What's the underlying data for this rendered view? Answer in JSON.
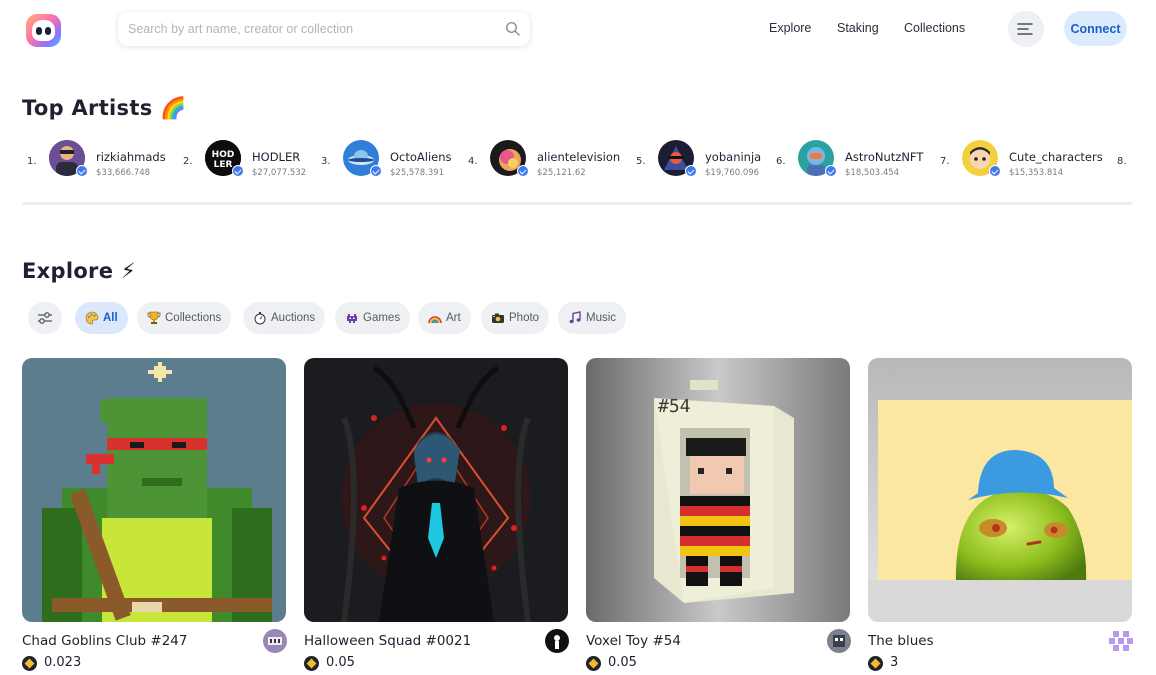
{
  "header": {
    "search_placeholder": "Search by art name, creator or collection",
    "nav": [
      "Explore",
      "Staking",
      "Collections"
    ],
    "connect_label": "Connect"
  },
  "top_artists": {
    "title": "Top Artists 🌈",
    "items": [
      {
        "rank": "1.",
        "name": "rizkiahmads",
        "value": "$33,666.748"
      },
      {
        "rank": "2.",
        "name": "HODLER",
        "value": "$27,077.532"
      },
      {
        "rank": "3.",
        "name": "OctoAliens",
        "value": "$25,578.391"
      },
      {
        "rank": "4.",
        "name": "alientelevision",
        "value": "$25,121.62"
      },
      {
        "rank": "5.",
        "name": "yobaninja",
        "value": "$19,760.096"
      },
      {
        "rank": "6.",
        "name": "AstroNutzNFT",
        "value": "$18,503.454"
      },
      {
        "rank": "7.",
        "name": "Cute_characters",
        "value": "$15,353.814"
      },
      {
        "rank": "8.",
        "name": "",
        "value": ""
      }
    ]
  },
  "explore": {
    "title": "Explore ⚡",
    "filters": [
      {
        "label": "All",
        "icon": "palette-icon",
        "active": true
      },
      {
        "label": "Collections",
        "icon": "trophy-icon",
        "active": false
      },
      {
        "label": "Auctions",
        "icon": "stopwatch-icon",
        "active": false
      },
      {
        "label": "Games",
        "icon": "space-invader-icon",
        "active": false
      },
      {
        "label": "Art",
        "icon": "rainbow-icon",
        "active": false
      },
      {
        "label": "Photo",
        "icon": "camera-icon",
        "active": false
      },
      {
        "label": "Music",
        "icon": "music-note-icon",
        "active": false
      }
    ],
    "cards": [
      {
        "title": "Chad Goblins Club #247",
        "price": "0.023"
      },
      {
        "title": "Halloween Squad #0021",
        "price": "0.05"
      },
      {
        "title": "Voxel Toy #54",
        "price": "0.05"
      },
      {
        "title": "The blues",
        "price": "3"
      }
    ]
  },
  "artwork_text": {
    "voxel_label": "#54",
    "hodler_logo": "HOD LER"
  },
  "colors": {
    "accent": "#1b5fc4",
    "accent_bg": "#dbeafd",
    "verified_badge": "#3f7bea"
  }
}
